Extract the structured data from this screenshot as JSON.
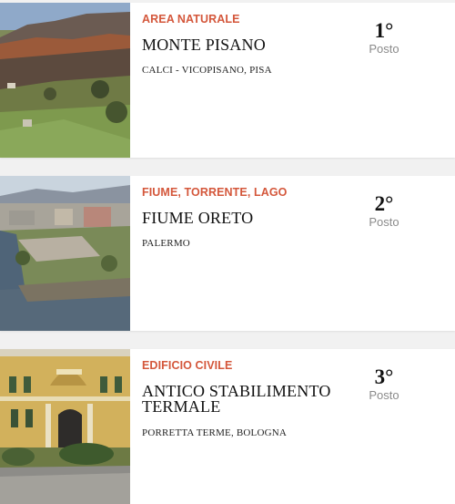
{
  "entries": [
    {
      "category": "AREA NATURALE",
      "title": "MONTE PISANO",
      "location": "CALCI - VICOPISANO, PISA",
      "rank": "1°",
      "rank_label": "Posto",
      "image": "burned-hillside-photo"
    },
    {
      "category": "FIUME, TORRENTE, LAGO",
      "title": "FIUME ORETO",
      "location": "PALERMO",
      "rank": "2°",
      "rank_label": "Posto",
      "image": "river-and-city-photo"
    },
    {
      "category": "EDIFICIO CIVILE",
      "title": "ANTICO STABILIMENTO TERMALE",
      "location": "PORRETTA TERME, BOLOGNA",
      "rank": "3°",
      "rank_label": "Posto",
      "image": "historic-building-photo"
    }
  ],
  "colors": {
    "category": "#d4573b",
    "title": "#111111",
    "rank_label": "#8a8a8a",
    "background": "#f1f1f1"
  }
}
